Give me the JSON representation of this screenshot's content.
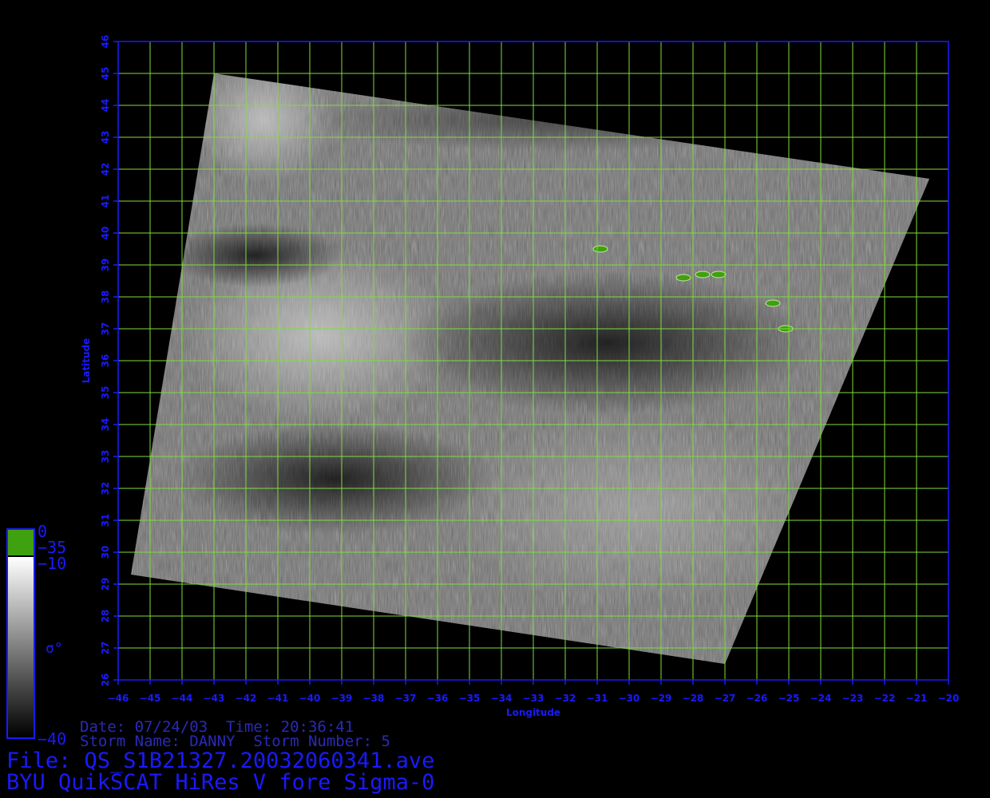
{
  "chart_data": {
    "type": "map",
    "title": "BYU QuikSCAT HiRes V fore Sigma-0",
    "xlabel": "Longitude",
    "ylabel": "Latitude",
    "xlim": [
      -46,
      -20
    ],
    "ylim": [
      26,
      46
    ],
    "x_ticks": [
      -46,
      -45,
      -44,
      -43,
      -42,
      -41,
      -40,
      -39,
      -38,
      -37,
      -36,
      -35,
      -34,
      -33,
      -32,
      -31,
      -30,
      -29,
      -28,
      -27,
      -26,
      -25,
      -24,
      -23,
      -22,
      -21,
      -20
    ],
    "y_ticks": [
      26,
      27,
      28,
      29,
      30,
      31,
      32,
      33,
      34,
      35,
      36,
      37,
      38,
      39,
      40,
      41,
      42,
      43,
      44,
      45,
      46
    ],
    "grid": true,
    "grid_color": "#7fdc3a",
    "axis_color": "#1a1aff",
    "swath_corners_lonlat": [
      [
        -43,
        45
      ],
      [
        -20.6,
        41.7
      ],
      [
        -27,
        26.5
      ],
      [
        -45.6,
        29.3
      ]
    ],
    "land_features": [
      {
        "lon": -30.9,
        "lat": 39.5
      },
      {
        "lon": -28.3,
        "lat": 38.6
      },
      {
        "lon": -27.7,
        "lat": 38.7
      },
      {
        "lon": -27.2,
        "lat": 38.7
      },
      {
        "lon": -25.5,
        "lat": 37.8
      },
      {
        "lon": -25.1,
        "lat": 37.0
      }
    ],
    "colorbar": {
      "unit_symbol": "σ°",
      "labels": [
        "0",
        "−35",
        "−10",
        "−40"
      ],
      "land_color": "#3fa010"
    }
  },
  "info": {
    "date_line": "Date: 07/24/03  Time: 20:36:41",
    "storm_line": "Storm Name: DANNY  Storm Number: 5",
    "file_line": "File: QS_S1B21327.20032060341.ave",
    "product_line": "BYU QuikSCAT HiRes V fore Sigma-0"
  }
}
